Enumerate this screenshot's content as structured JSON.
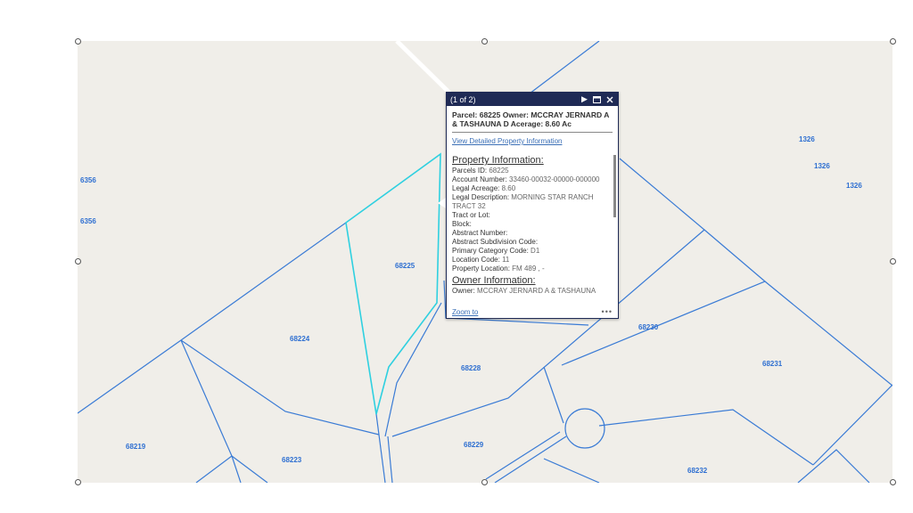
{
  "map": {
    "parcel_labels": [
      {
        "id": "p6356a",
        "text": "6356"
      },
      {
        "id": "p6356b",
        "text": "6356"
      },
      {
        "id": "p68225",
        "text": "68225"
      },
      {
        "id": "p68224",
        "text": "68224"
      },
      {
        "id": "p68228",
        "text": "68228"
      },
      {
        "id": "p68230",
        "text": "68230"
      },
      {
        "id": "p68231",
        "text": "68231"
      },
      {
        "id": "p68219",
        "text": "68219"
      },
      {
        "id": "p68223",
        "text": "68223"
      },
      {
        "id": "p68229",
        "text": "68229"
      },
      {
        "id": "p68232",
        "text": "68232"
      },
      {
        "id": "p1326a",
        "text": "1326"
      },
      {
        "id": "p1326b",
        "text": "1326"
      },
      {
        "id": "p1326c",
        "text": "1326"
      }
    ],
    "colors": {
      "background": "#f0eee9",
      "parcel_line": "#3a7bd5",
      "selected_parcel": "#2fd0e0",
      "road": "#ffffff"
    }
  },
  "popup": {
    "count": "(1 of 2)",
    "icons": [
      "next-icon",
      "maximize-icon",
      "close-icon"
    ],
    "title": "Parcel: 68225 Owner: MCCRAY JERNARD A & TASHAUNA D Acerage: 8.60 Ac",
    "detail_link": "View Detailed Property Information",
    "property_heading": "Property Information:",
    "fields": {
      "parcels_id": {
        "label": "Parcels ID:",
        "value": "68225"
      },
      "account_number": {
        "label": "Account Number:",
        "value": "33460-00032-00000-000000"
      },
      "legal_acreage": {
        "label": "Legal Acreage:",
        "value": "8.60"
      },
      "legal_description": {
        "label": "Legal Description:",
        "value": "MORNING STAR RANCH TRACT 32"
      },
      "tract_or_lot": {
        "label": "Tract or Lot:",
        "value": ""
      },
      "block": {
        "label": "Block:",
        "value": ""
      },
      "abstract_number": {
        "label": "Abstract Number:",
        "value": ""
      },
      "abstract_subdivision_code": {
        "label": "Abstract Subdivision Code:",
        "value": ""
      },
      "primary_category_code": {
        "label": "Primary Category Code:",
        "value": "D1"
      },
      "location_code": {
        "label": "Location Code:",
        "value": "11"
      },
      "property_location": {
        "label": "Property Location:",
        "value": "FM 489 , -"
      }
    },
    "owner_heading": "Owner Information:",
    "owner": {
      "label": "Owner:",
      "value": "MCCRAY JERNARD A & TASHAUNA"
    },
    "zoom_link": "Zoom to",
    "more_label": "•••"
  }
}
